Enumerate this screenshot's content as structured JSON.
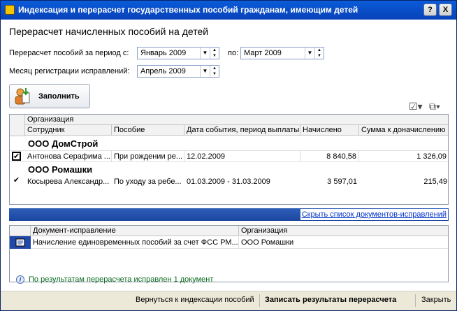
{
  "window": {
    "title": "Индексация и перерасчет государственных пособий гражданам, имеющим детей",
    "help_label": "?",
    "close_label": "X"
  },
  "form": {
    "heading": "Перерасчет начисленных пособий на детей",
    "period_label": "Перерасчет пособий за период с:",
    "period_from": "Январь 2009",
    "period_to_label": "по:",
    "period_to": "Март 2009",
    "reg_month_label": "Месяц регистрации исправлений:",
    "reg_month": "Апрель 2009",
    "fill_button": "Заполнить"
  },
  "table": {
    "headers": {
      "organization": "Организация",
      "employee": "Сотрудник",
      "benefit": "Пособие",
      "event_date": "Дата события, период выплаты",
      "accrued": "Начислено",
      "extra": "Сумма к доначислению"
    },
    "groups": [
      {
        "name": "ООО ДомСтрой",
        "rows": [
          {
            "employee": "Антонова Серафима ...",
            "benefit": "При рождении ре...",
            "event_date": "12.02.2009",
            "accrued": "8 840,58",
            "extra": "1 326,09",
            "checked": "✔"
          }
        ]
      },
      {
        "name": "ООО Ромашки",
        "rows": [
          {
            "employee": "Косырева Александр...",
            "benefit": "По уходу за ребе...",
            "event_date": "01.03.2009 - 31.03.2009",
            "accrued": "3 597,01",
            "extra": "215,49",
            "checked": "✔"
          }
        ]
      }
    ]
  },
  "hide_link": "Скрыть список документов-исправлений",
  "docs": {
    "headers": {
      "document": "Документ-исправление",
      "organization": "Организация"
    },
    "rows": [
      {
        "document": "Начисление единовременных пособий за счет ФСС РМ...",
        "organization": "ООО Ромашки"
      }
    ]
  },
  "info_message": "По результатам перерасчета исправлен 1 документ",
  "footer": {
    "back": "Вернуться к индексации пособий",
    "save": "Записать результаты перерасчета",
    "close": "Закрыть"
  },
  "icons": {
    "fill": "user-add-icon",
    "info": "info-icon",
    "settings": "checklist-icon",
    "windows": "windows-icon"
  }
}
